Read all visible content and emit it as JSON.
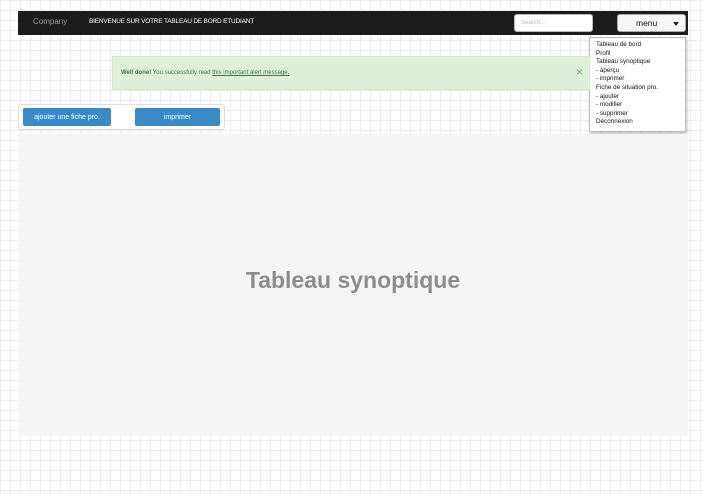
{
  "navbar": {
    "brand": "Company",
    "welcome_text": "BIENVENUE SUR VOTRE TABLEAU DE BORD ETUDIANT",
    "search_placeholder": "Search...",
    "menu_label": "menu"
  },
  "dropdown": {
    "items": [
      "Tableau de bord",
      "Profil",
      "Tableau synoptique",
      "- aperçu",
      "- imprimer",
      "Fiche de situation pro.",
      "- ajouter",
      "- modifier",
      "- supprimer",
      "Déconnexion"
    ]
  },
  "alert": {
    "strong": "Well done!",
    "text": "You successfully read",
    "link": "this important alert message.",
    "close_symbol": "×"
  },
  "toolbar": {
    "add_label": "ajouter une fiche pro.",
    "print_label": "imprimer"
  },
  "panel": {
    "title": "Tableau synoptique"
  },
  "colors": {
    "navbar_bg": "#1c1c1c",
    "button_blue": "#3a89c9",
    "alert_bg": "#dff0d8",
    "alert_text": "#3c763d"
  }
}
